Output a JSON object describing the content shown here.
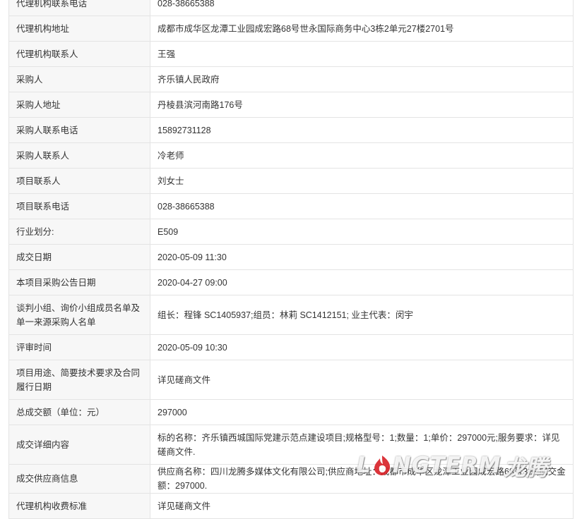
{
  "rows": [
    {
      "label": "代理机构联系电话",
      "value": "028-38665388"
    },
    {
      "label": "代理机构地址",
      "value": "成都市成华区龙潭工业园成宏路68号世永国际商务中心3栋2单元27楼2701号"
    },
    {
      "label": "代理机构联系人",
      "value": "王强"
    },
    {
      "label": "采购人",
      "value": "齐乐镇人民政府"
    },
    {
      "label": "采购人地址",
      "value": "丹棱县滨河南路176号"
    },
    {
      "label": "采购人联系电话",
      "value": "15892731128"
    },
    {
      "label": "采购人联系人",
      "value": "冷老师"
    },
    {
      "label": "项目联系人",
      "value": "刘女士"
    },
    {
      "label": "项目联系电话",
      "value": "028-38665388"
    },
    {
      "label": "行业划分:",
      "value": "E509"
    },
    {
      "label": "成交日期",
      "value": "2020-05-09 11:30"
    },
    {
      "label": "本项目采购公告日期",
      "value": "2020-04-27 09:00"
    },
    {
      "label": "谈判小组、询价小组成员名单及单一来源采购人名单",
      "value": "组长：程锋 SC1405937;组员：林莉 SC1412151; 业主代表：闵宇"
    },
    {
      "label": "评审时间",
      "value": "2020-05-09 10:30"
    },
    {
      "label": "项目用途、简要技术要求及合同履行日期",
      "value": "详见磋商文件"
    },
    {
      "label": "总成交额（单位：元）",
      "value": "297000"
    },
    {
      "label": "成交详细内容",
      "value": "标的名称：齐乐镇西城国际党建示范点建设项目;规格型号：1;数量：1;单价：297000元;服务要求：详见磋商文件."
    },
    {
      "label": "成交供应商信息",
      "value": "供应商名称：四川龙腾多媒体文化有限公司;供应商地址：成都市成华区龙潭工业园成宏路68号3栋;成交金额：297000."
    },
    {
      "label": "代理机构收费标准",
      "value": "详见磋商文件"
    }
  ],
  "watermark": {
    "text_left": "L",
    "text_right": "NGTERM",
    "text_cn": "龙腾",
    "mark_color": "#d9242b"
  }
}
